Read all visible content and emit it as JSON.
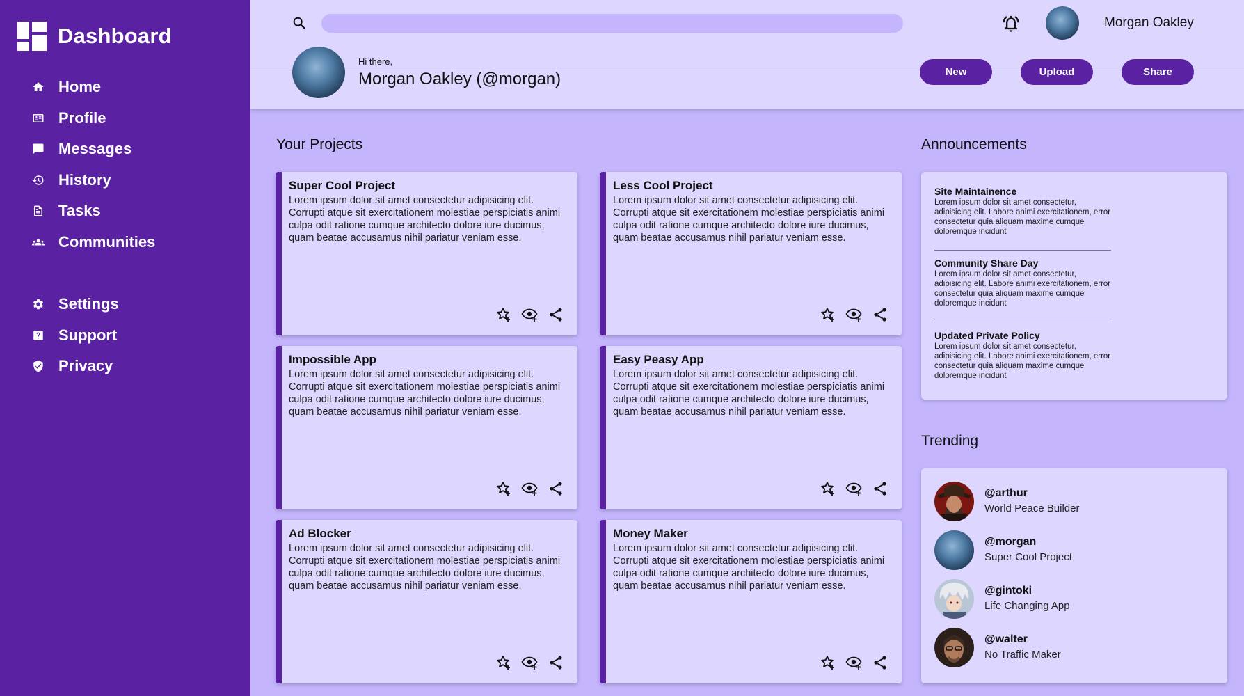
{
  "sidebar": {
    "brand": "Dashboard",
    "items": [
      {
        "label": "Home",
        "icon": "home-icon"
      },
      {
        "label": "Profile",
        "icon": "profile-icon"
      },
      {
        "label": "Messages",
        "icon": "messages-icon"
      },
      {
        "label": "History",
        "icon": "history-icon"
      },
      {
        "label": "Tasks",
        "icon": "tasks-icon"
      },
      {
        "label": "Communities",
        "icon": "communities-icon"
      }
    ],
    "secondary": [
      {
        "label": "Settings",
        "icon": "gear-icon"
      },
      {
        "label": "Support",
        "icon": "help-icon"
      },
      {
        "label": "Privacy",
        "icon": "shield-icon"
      }
    ]
  },
  "header": {
    "search_placeholder": "",
    "username": "Morgan Oakley",
    "greeting": "Hi there,",
    "full_name": "Morgan Oakley (@morgan)",
    "buttons": {
      "new": "New",
      "upload": "Upload",
      "share": "Share"
    }
  },
  "projects": {
    "title": "Your Projects",
    "items": [
      {
        "title": "Super Cool Project",
        "desc": "Lorem ipsum dolor sit amet consectetur adipisicing elit. Corrupti atque sit exercitationem molestiae perspiciatis animi culpa odit ratione cumque architecto dolore iure ducimus, quam beatae accusamus nihil pariatur veniam esse."
      },
      {
        "title": "Less Cool Project",
        "desc": "Lorem ipsum dolor sit amet consectetur adipisicing elit. Corrupti atque sit exercitationem molestiae perspiciatis animi culpa odit ratione cumque architecto dolore iure ducimus, quam beatae accusamus nihil pariatur veniam esse."
      },
      {
        "title": "Impossible App",
        "desc": "Lorem ipsum dolor sit amet consectetur adipisicing elit. Corrupti atque sit exercitationem molestiae perspiciatis animi culpa odit ratione cumque architecto dolore iure ducimus, quam beatae accusamus nihil pariatur veniam esse."
      },
      {
        "title": "Easy Peasy App",
        "desc": "Lorem ipsum dolor sit amet consectetur adipisicing elit. Corrupti atque sit exercitationem molestiae perspiciatis animi culpa odit ratione cumque architecto dolore iure ducimus, quam beatae accusamus nihil pariatur veniam esse."
      },
      {
        "title": "Ad Blocker",
        "desc": "Lorem ipsum dolor sit amet consectetur adipisicing elit. Corrupti atque sit exercitationem molestiae perspiciatis animi culpa odit ratione cumque architecto dolore iure ducimus, quam beatae accusamus nihil pariatur veniam esse."
      },
      {
        "title": "Money Maker",
        "desc": "Lorem ipsum dolor sit amet consectetur adipisicing elit. Corrupti atque sit exercitationem molestiae perspiciatis animi culpa odit ratione cumque architecto dolore iure ducimus, quam beatae accusamus nihil pariatur veniam esse."
      }
    ]
  },
  "announcements": {
    "title": "Announcements",
    "items": [
      {
        "title": "Site Maintainence",
        "body": "Lorem ipsum dolor sit amet consectetur, adipisicing elit. Labore animi exercitationem, error consectetur quia aliquam maxime cumque doloremque incidunt"
      },
      {
        "title": "Community Share Day",
        "body": "Lorem ipsum dolor sit amet consectetur, adipisicing elit. Labore animi exercitationem, error consectetur quia aliquam maxime cumque doloremque incidunt"
      },
      {
        "title": "Updated Private Policy",
        "body": "Lorem ipsum dolor sit amet consectetur, adipisicing elit. Labore animi exercitationem, error consectetur quia aliquam maxime cumque doloremque incidunt"
      }
    ]
  },
  "trending": {
    "title": "Trending",
    "items": [
      {
        "handle": "@arthur",
        "subtitle": "World Peace Builder"
      },
      {
        "handle": "@morgan",
        "subtitle": "Super Cool Project"
      },
      {
        "handle": "@gintoki",
        "subtitle": "Life Changing App"
      },
      {
        "handle": "@walter",
        "subtitle": "No Traffic Maker"
      }
    ]
  },
  "colors": {
    "sidebar": "#5a22a3",
    "background": "#c4b5fd",
    "surface": "#ddd6fe",
    "accent": "#5a22a3"
  }
}
